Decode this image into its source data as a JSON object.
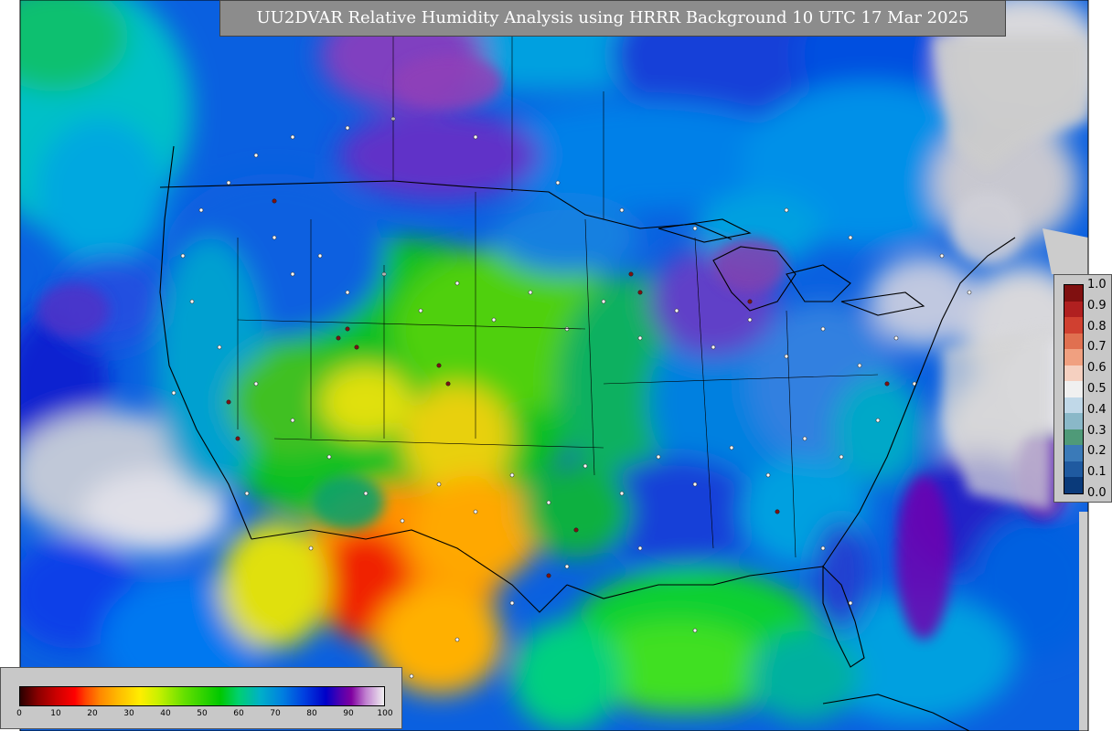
{
  "title": "UU2DVAR Relative Humidity Analysis using HRRR Background 10 UTC 17 Mar 2025",
  "obs_colorbar": {
    "ticks": [
      "0.0",
      "0.1",
      "0.2",
      "0.3",
      "0.4",
      "0.5",
      "0.6",
      "0.7",
      "0.8",
      "0.9",
      "1.0"
    ],
    "colors": [
      "#0a3a7a",
      "#1f5aa0",
      "#3a7ab8",
      "#4f9a78",
      "#8ab8c8",
      "#c0d8e8",
      "#f0f0f0",
      "#f5d0c0",
      "#f0a080",
      "#e07050",
      "#d04030",
      "#b02020",
      "#801010"
    ]
  },
  "rh_colorbar": {
    "ticks": [
      "0",
      "10",
      "20",
      "30",
      "40",
      "50",
      "60",
      "70",
      "80",
      "90",
      "100"
    ]
  },
  "colors": {
    "title_bg": "#8c8c8c",
    "legend_bg": "#c8c8c8",
    "land_missing": "#cccccc",
    "ocean_humid": "#00b0e0"
  }
}
